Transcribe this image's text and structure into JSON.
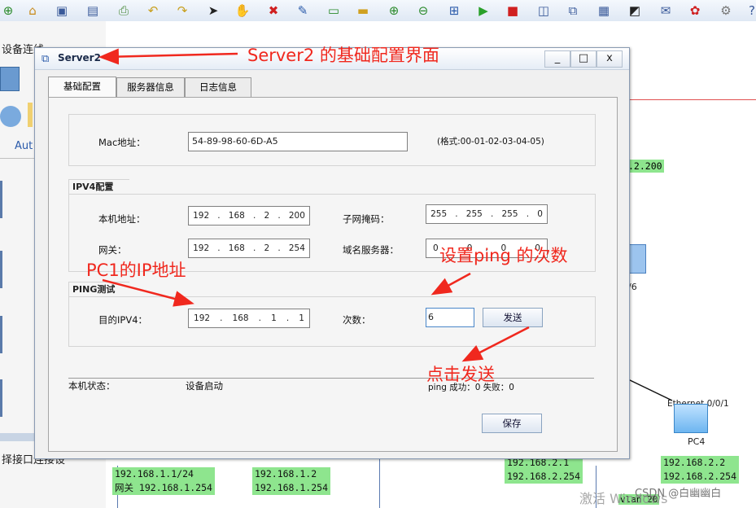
{
  "toolbar": {
    "icons": [
      "add-icon",
      "home-icon",
      "save-icon",
      "save-as-icon",
      "print-icon",
      "undo-icon",
      "redo-icon",
      "pointer-icon",
      "hand-icon",
      "delete-icon",
      "clear-icon",
      "text-icon",
      "rectangle-icon",
      "zoom-in-icon",
      "zoom-out-icon",
      "fit-icon",
      "start-icon",
      "stop-icon",
      "capture-icon",
      "topology-icon",
      "grid-icon",
      "screenshot-icon",
      "message-icon",
      "huawei-icon",
      "settings-icon",
      "help-icon"
    ]
  },
  "left_panel": {
    "title": "设备连线",
    "auto_label": "Aut",
    "bottom_text": "择接口连接设"
  },
  "topology": {
    "label_top_right": ".2.200",
    "label_device_right": "/6",
    "link_label": "Ethernet 0/0/1",
    "pc_label": "PC4",
    "box1_line1": "192.168.1.1/24",
    "box1_line2": "网关 192.168.1.254",
    "box2_line1": "192.168.1.2",
    "box2_line2": "192.168.1.254",
    "box3_line1": "192.168.2.1",
    "box3_line2": "192.168.2.254",
    "box4_line1": "192.168.2.2",
    "box4_line2": "192.168.2.254",
    "vlan_label": "vlan 20",
    "watermark_activate": "激活 Windows",
    "watermark_csdn": "CSDN @白幽幽白"
  },
  "dialog": {
    "title": "Server2",
    "min_label": "_",
    "max_label": "□",
    "close_label": "x",
    "tabs": [
      "基础配置",
      "服务器信息",
      "日志信息"
    ],
    "mac_label": "Mac地址：",
    "mac_value": "54-89-98-60-6D-A5",
    "mac_hint": "(格式:00-01-02-03-04-05)",
    "ipv4_group": "IPV4配置",
    "host_ip_label": "本机地址：",
    "host_ip": [
      "192",
      "168",
      "2",
      "200"
    ],
    "mask_label": "子网掩码：",
    "mask": [
      "255",
      "255",
      "255",
      "0"
    ],
    "gateway_label": "网关：",
    "gateway": [
      "192",
      "168",
      "2",
      "254"
    ],
    "dns_label": "域名服务器：",
    "dns": [
      "0",
      "0",
      "0",
      "0"
    ],
    "ping_group": "PING测试",
    "dest_label": "目的IPV4：",
    "dest_ip": [
      "192",
      "168",
      "1",
      "1"
    ],
    "count_label": "次数：",
    "count_value": "6",
    "send_button": "发送",
    "status_label": "本机状态：",
    "status_value": "设备启动",
    "ping_result": "ping 成功：0   失败：0",
    "save_button": "保存"
  },
  "annotations": {
    "title_note": "Server2 的基础配置界面",
    "pc1_note": "PC1的IP地址",
    "ping_count_note": "设置ping 的次数",
    "click_send_note": "点击发送"
  },
  "colors": {
    "annotation_red": "#f0281e",
    "topology_green": "#8ee58e"
  }
}
